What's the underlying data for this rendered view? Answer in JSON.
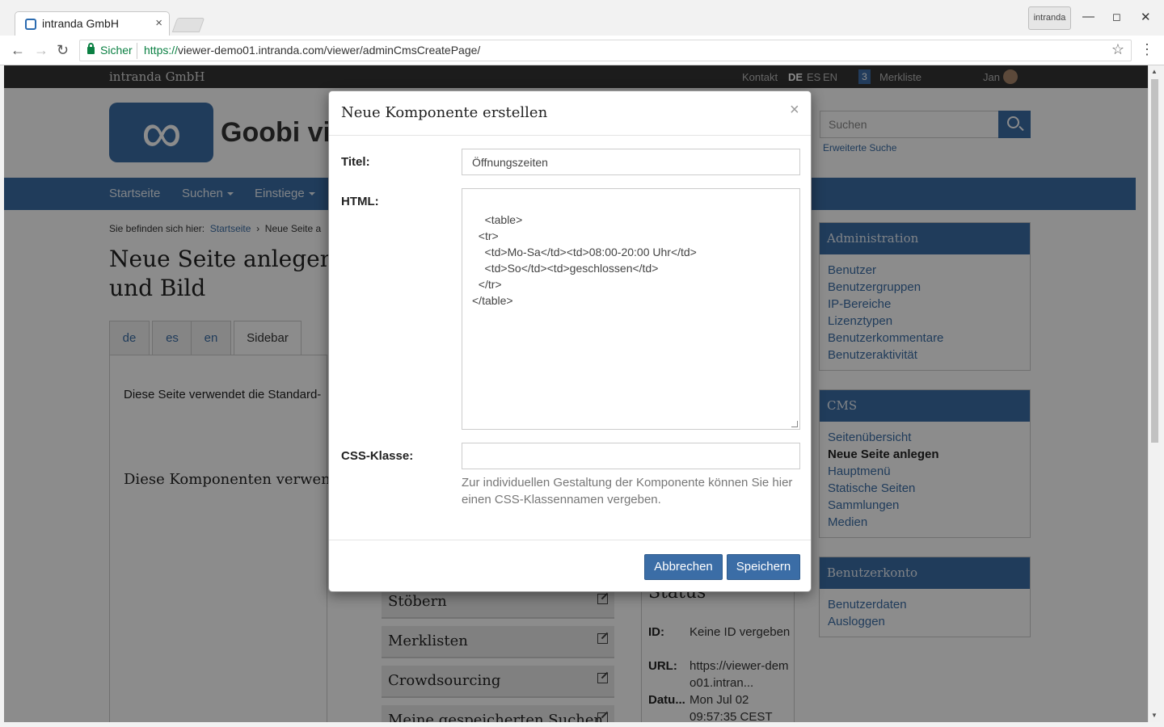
{
  "browser": {
    "tab_title": "intranda GmbH",
    "tab_close": "×",
    "profile_label": "intranda",
    "secure_label": "Sicher",
    "url_scheme": "https://",
    "url_rest": "viewer-demo01.intranda.com/viewer/adminCmsCreatePage/"
  },
  "topbar": {
    "brand": "intranda GmbH",
    "contact": "Kontakt",
    "lang_de": "DE",
    "lang_es": "ES",
    "lang_en": "EN",
    "bookmark_count": "3",
    "bookmarks": "Merkliste",
    "user": "Jan"
  },
  "header": {
    "logo_text": "Goobi vie",
    "search_placeholder": "Suchen",
    "advanced_search": "Erweiterte Suche"
  },
  "nav": {
    "items": [
      "Startseite",
      "Suchen",
      "Einstiege"
    ]
  },
  "breadcrumb": {
    "prefix": "Sie befinden sich hier:",
    "home": "Startseite",
    "sep": "›",
    "current": "Neue Seite a"
  },
  "page": {
    "title": "Neue Seite anlegen: und Bild",
    "tabs": [
      "de",
      "es",
      "en",
      "Sidebar"
    ],
    "info_text": "Diese Seite verwendet die Standard-",
    "components_heading": "Diese Komponenten verwen",
    "components": [
      "Stöbern",
      "Merklisten",
      "Crowdsourcing",
      "Meine gespeicherten Suchen"
    ]
  },
  "status": {
    "title": "Status",
    "id_label": "ID:",
    "id_value": "Keine ID vergeben",
    "url_label": "URL:",
    "url_value": "https://viewer-demo01.intran...",
    "date_label": "Datu...",
    "date_value": "Mon Jul 02 09:57:35 CEST"
  },
  "sidebar": {
    "admin": {
      "title": "Administration",
      "items": [
        "Benutzer",
        "Benutzergruppen",
        "IP-Bereiche",
        "Lizenztypen",
        "Benutzerkommentare",
        "Benutzeraktivität"
      ]
    },
    "cms": {
      "title": "CMS",
      "items": [
        "Seitenübersicht",
        "Neue Seite anlegen",
        "Hauptmenü",
        "Statische Seiten",
        "Sammlungen",
        "Medien"
      ]
    },
    "account": {
      "title": "Benutzerkonto",
      "items": [
        "Benutzerdaten",
        "Ausloggen"
      ]
    }
  },
  "modal": {
    "title": "Neue Komponente erstellen",
    "close": "×",
    "title_label": "Titel:",
    "title_value": "Öffnungszeiten",
    "html_label": "HTML:",
    "html_value": "<table>\n  <tr>\n    <td>Mo-Sa</td><td>08:00-20:00 Uhr</td>\n    <td>So</td><td>geschlossen</td>\n  </tr>\n</table>",
    "css_label": "CSS-Klasse:",
    "css_value": "",
    "css_help": "Zur individuellen Gestaltung der Komponente können Sie hier einen CSS-Klassennamen vergeben.",
    "cancel": "Abbrechen",
    "save": "Speichern"
  }
}
